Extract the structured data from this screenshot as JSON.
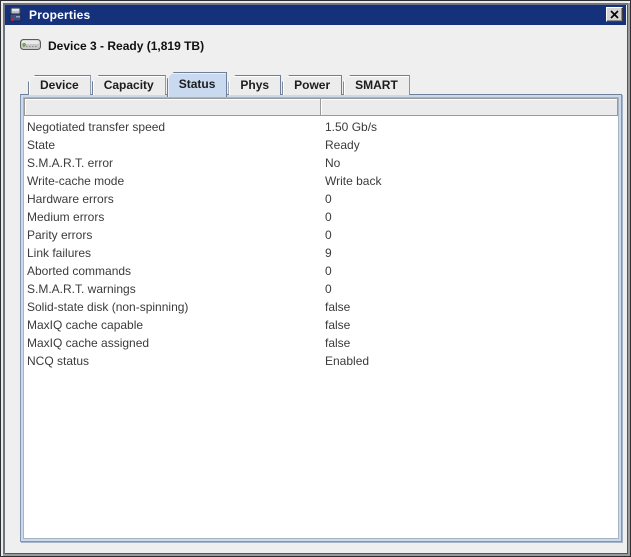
{
  "window": {
    "title": "Properties",
    "close_icon": "close-x"
  },
  "device_header": {
    "icon": "disk-drive-icon",
    "label": "Device 3 - Ready (1,819 TB)"
  },
  "tabs": [
    {
      "label": "Device",
      "selected": false
    },
    {
      "label": "Capacity",
      "selected": false
    },
    {
      "label": "Status",
      "selected": true
    },
    {
      "label": "Phys",
      "selected": false
    },
    {
      "label": "Power",
      "selected": false
    },
    {
      "label": "SMART",
      "selected": false
    }
  ],
  "table": {
    "columns": [
      "",
      ""
    ],
    "rows": [
      {
        "property": "Negotiated transfer speed",
        "value": "1.50 Gb/s"
      },
      {
        "property": "State",
        "value": "Ready"
      },
      {
        "property": "S.M.A.R.T. error",
        "value": "No"
      },
      {
        "property": "Write-cache mode",
        "value": "Write back"
      },
      {
        "property": "Hardware errors",
        "value": "0"
      },
      {
        "property": "Medium errors",
        "value": "0"
      },
      {
        "property": "Parity errors",
        "value": "0"
      },
      {
        "property": "Link failures",
        "value": "9"
      },
      {
        "property": "Aborted commands",
        "value": "0"
      },
      {
        "property": "S.M.A.R.T. warnings",
        "value": "0"
      },
      {
        "property": "Solid-state disk (non-spinning)",
        "value": "false"
      },
      {
        "property": "MaxIQ cache capable",
        "value": "false"
      },
      {
        "property": "MaxIQ cache assigned",
        "value": "false"
      },
      {
        "property": "NCQ status",
        "value": "Enabled"
      }
    ]
  },
  "colors": {
    "titlebar": "#15317c",
    "titlebar_text": "#ffffff",
    "selected_tab": "#c8d9f0",
    "pane_border": "#8296ad",
    "led_green": "#7dc243"
  }
}
